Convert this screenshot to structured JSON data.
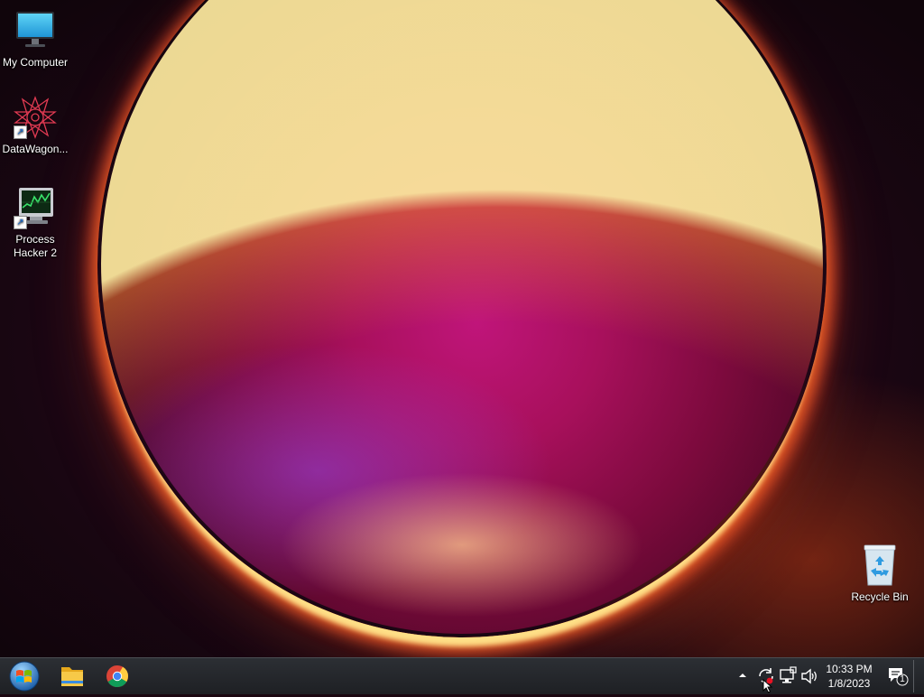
{
  "desktop": {
    "icons": [
      {
        "label": "My Computer",
        "icon": "monitor-icon"
      },
      {
        "label": "DataWagon...",
        "icon": "datawagon-logo-icon",
        "shortcut": true
      },
      {
        "label": "Process Hacker 2",
        "icon": "process-hacker-icon",
        "shortcut": true
      },
      {
        "label": "Recycle Bin",
        "icon": "recycle-bin-icon"
      }
    ]
  },
  "taskbar": {
    "start_icon": "windows-start-orb-icon",
    "pinned_apps": [
      {
        "name": "File Explorer",
        "icon": "folder-icon"
      },
      {
        "name": "Google Chrome",
        "icon": "chrome-icon"
      }
    ],
    "tray": {
      "overflow_icon": "chevron-up-icon",
      "icons": [
        "sync-icon",
        "network-icon",
        "volume-icon"
      ],
      "notification_count": "1"
    },
    "clock": {
      "time": "10:33 PM",
      "date": "1/8/2023"
    }
  }
}
